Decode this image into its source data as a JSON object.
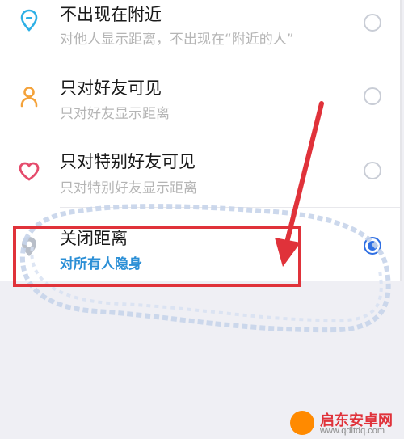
{
  "options": [
    {
      "title": "不出现在附近",
      "subtitle": "对他人显示距离，不出现在“附近的人”",
      "selected": false,
      "icon": "location-pin-icon"
    },
    {
      "title": "只对好友可见",
      "subtitle": "只对好友显示距离",
      "selected": false,
      "icon": "person-icon"
    },
    {
      "title": "只对特别好友可见",
      "subtitle": "只对特别好友显示距离",
      "selected": false,
      "icon": "heart-icon"
    },
    {
      "title": "关闭距离",
      "subtitle": "对所有人隐身",
      "selected": true,
      "icon": "location-off-icon"
    }
  ],
  "colors": {
    "accent": "#2f6fe3",
    "selected_subtitle": "#2b8fd6",
    "annotation": "#e0323a",
    "icon_blue": "#2db0e6",
    "icon_orange": "#f4a23a",
    "icon_pink": "#e54b6c"
  },
  "watermark": {
    "name": "启东安卓网",
    "url": "www.qdltdq.com"
  }
}
